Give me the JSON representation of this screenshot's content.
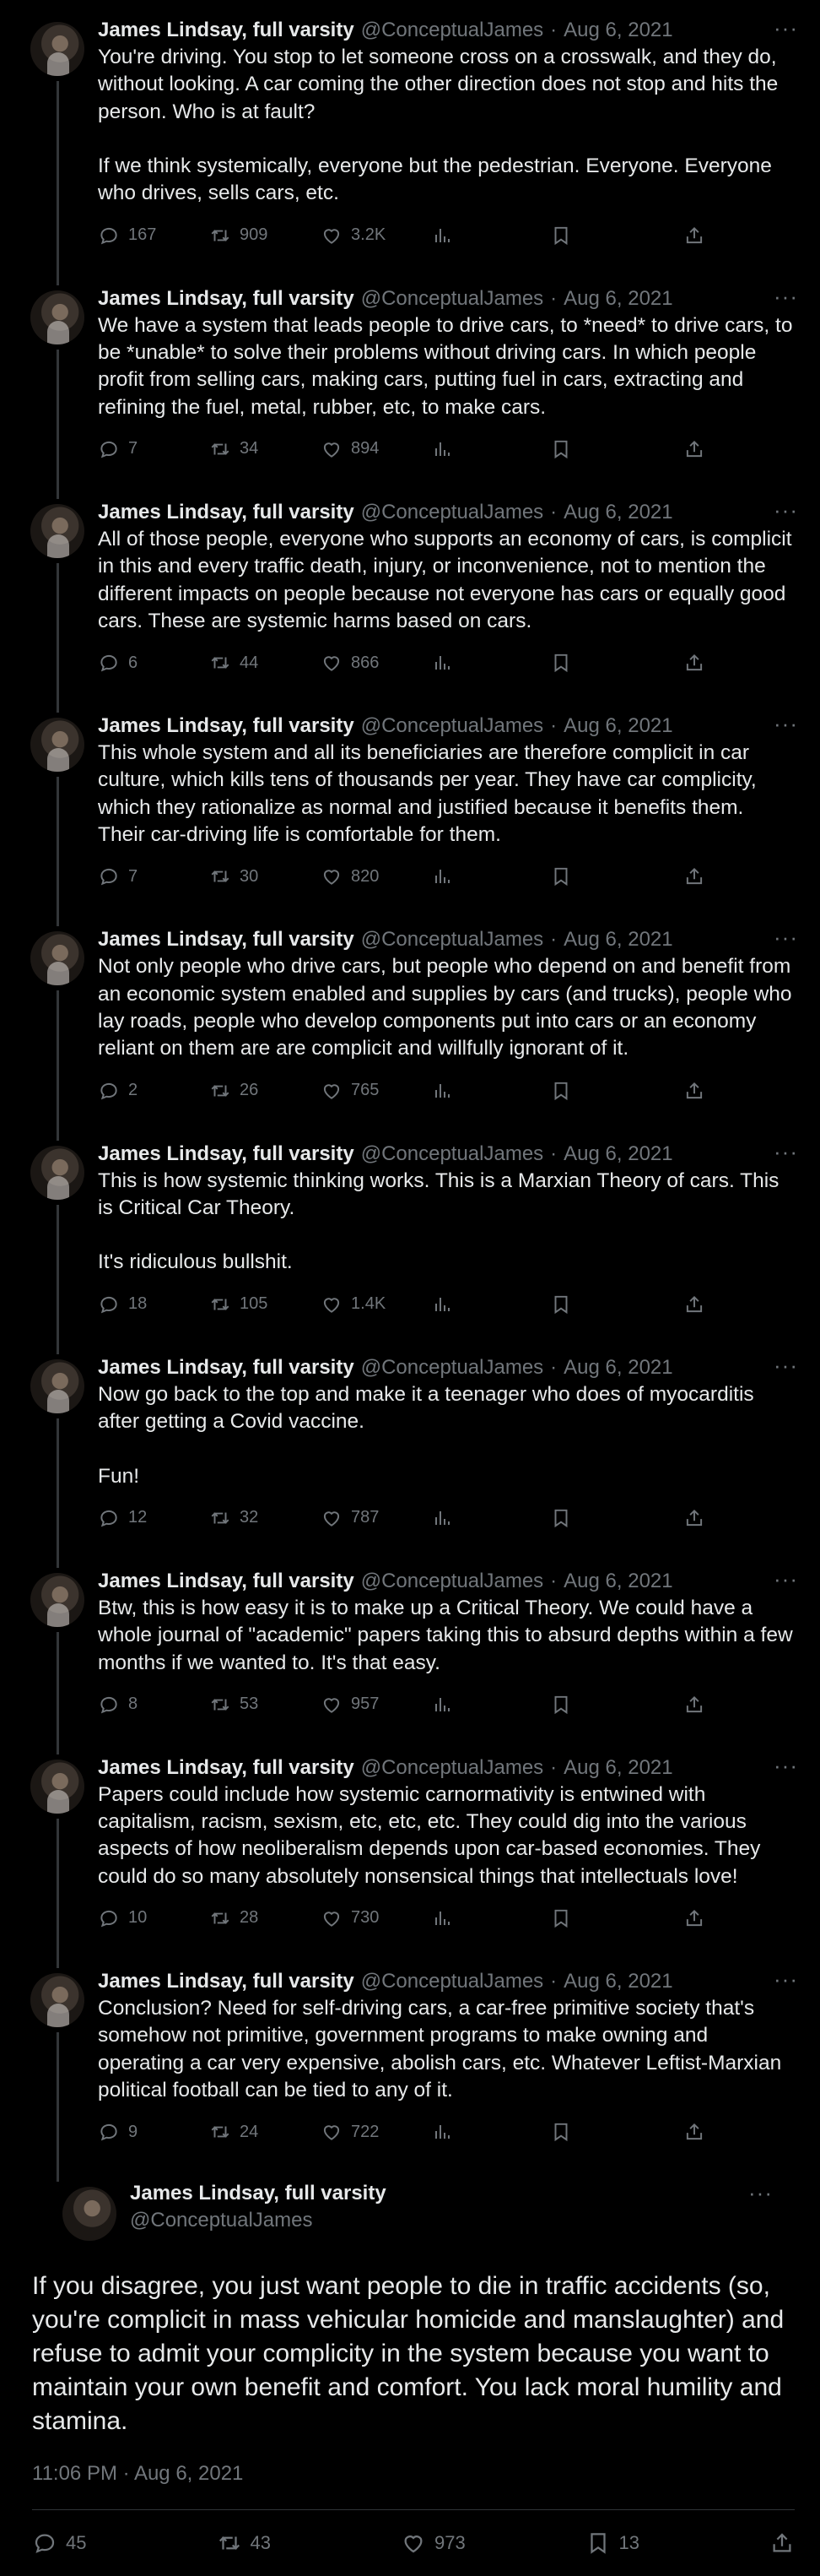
{
  "author": {
    "name": "James Lindsay, full varsity",
    "handle": "@ConceptualJames",
    "date": "Aug 6, 2021"
  },
  "ui": {
    "separator": "·",
    "more": "···"
  },
  "tweets": [
    {
      "text": "You're driving. You stop to let someone cross on a crosswalk, and they do, without looking. A car coming the other direction does not stop and hits the person. Who is at fault?\n\nIf we think systemically, everyone but the pedestrian. Everyone. Everyone who drives, sells cars, etc.",
      "replies": "167",
      "retweets": "909",
      "likes": "3.2K"
    },
    {
      "text": "We have a system that leads people to drive cars, to *need* to drive cars, to be *unable* to solve their problems without driving cars. In which people profit from selling cars, making cars, putting fuel in cars, extracting and refining the fuel, metal, rubber, etc, to make cars.",
      "replies": "7",
      "retweets": "34",
      "likes": "894"
    },
    {
      "text": "All of those people, everyone who supports an economy of cars, is complicit in this and every traffic death, injury, or inconvenience, not to mention the different impacts on people because not everyone has cars or equally good cars. These are systemic harms based on cars.",
      "replies": "6",
      "retweets": "44",
      "likes": "866"
    },
    {
      "text": "This whole system and all its beneficiaries are therefore complicit in car culture, which kills tens of thousands per year. They have car complicity, which they rationalize as normal and justified because it benefits them. Their car-driving life is comfortable for them.",
      "replies": "7",
      "retweets": "30",
      "likes": "820"
    },
    {
      "text": "Not only people who drive cars, but people who depend on and benefit from an economic system enabled and supplies by cars (and trucks), people who lay roads, people who develop components put into cars or an economy reliant on them are are complicit and willfully ignorant of it.",
      "replies": "2",
      "retweets": "26",
      "likes": "765"
    },
    {
      "text": "This is how systemic thinking works. This is a Marxian Theory of cars. This is Critical Car Theory.\n\nIt's ridiculous bullshit.",
      "replies": "18",
      "retweets": "105",
      "likes": "1.4K"
    },
    {
      "text": "Now go back to the top and make it a teenager who does of myocarditis after getting a Covid vaccine.\n\nFun!",
      "replies": "12",
      "retweets": "32",
      "likes": "787"
    },
    {
      "text": "Btw, this is how easy it is to make up a Critical Theory. We could have a whole journal of \"academic\" papers taking this to absurd depths within a few months if we wanted to. It's that easy.",
      "replies": "8",
      "retweets": "53",
      "likes": "957"
    },
    {
      "text": "Papers could include how systemic carnormativity is entwined with capitalism, racism, sexism, etc, etc, etc. They could dig into the various aspects of how neoliberalism depends upon car-based economies. They could do so many absolutely nonsensical things that intellectuals love!",
      "replies": "10",
      "retweets": "28",
      "likes": "730"
    },
    {
      "text": "Conclusion? Need for self-driving cars, a car-free primitive society that's somehow not primitive, government programs to make owning and operating a car very expensive, abolish cars, etc. Whatever Leftist-Marxian political football can be tied to any of it.",
      "replies": "9",
      "retweets": "24",
      "likes": "722"
    }
  ],
  "main": {
    "text": "If you disagree, you just want people to die in traffic accidents (so, you're complicit in mass vehicular homicide and manslaughter) and refuse to admit your complicity in the system because you want to maintain your own benefit and comfort. You lack moral humility and stamina.",
    "timestamp": "11:06 PM · Aug 6, 2021",
    "replies": "45",
    "retweets": "43",
    "likes": "973",
    "bookmarks": "13"
  },
  "colors": {
    "background": "#000000",
    "text": "#e7e9ea",
    "muted": "#71767b",
    "thread_line": "#333639"
  },
  "icons": [
    "reply-icon",
    "retweet-icon",
    "like-icon",
    "views-icon",
    "bookmark-icon",
    "share-icon",
    "more-icon"
  ]
}
